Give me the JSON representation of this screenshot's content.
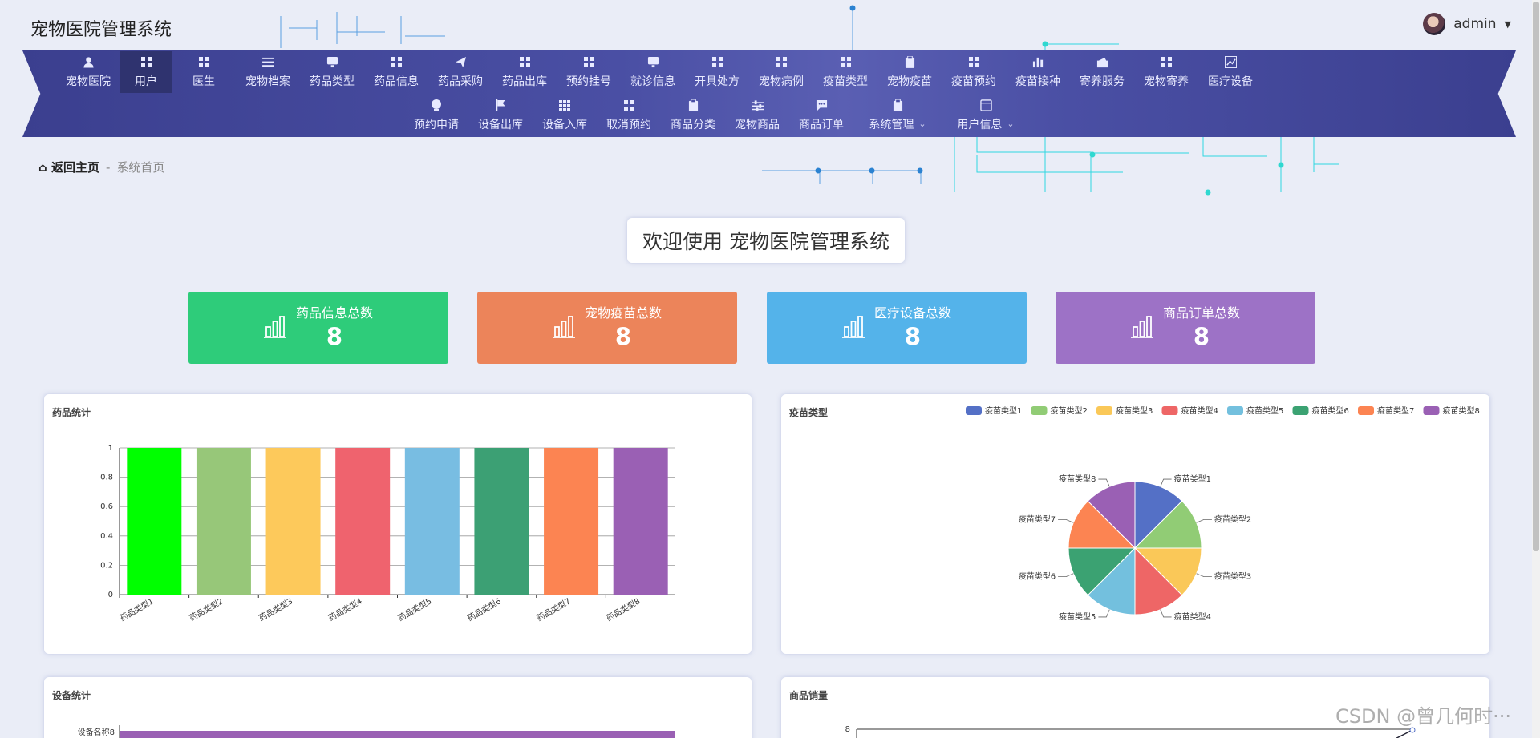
{
  "app": {
    "title": "宠物医院管理系统"
  },
  "user": {
    "name": "admin"
  },
  "nav": {
    "row1": [
      {
        "label": "宠物医院",
        "icon": "user-icon"
      },
      {
        "label": "用户",
        "icon": "grid-icon",
        "active": true
      },
      {
        "label": "医生",
        "icon": "grid-icon"
      },
      {
        "label": "宠物档案",
        "icon": "list-icon"
      },
      {
        "label": "药品类型",
        "icon": "monitor-icon"
      },
      {
        "label": "药品信息",
        "icon": "grid-icon"
      },
      {
        "label": "药品采购",
        "icon": "send-icon"
      },
      {
        "label": "药品出库",
        "icon": "grid-icon"
      },
      {
        "label": "预约挂号",
        "icon": "grid-icon"
      },
      {
        "label": "就诊信息",
        "icon": "monitor-icon"
      },
      {
        "label": "开具处方",
        "icon": "grid-icon"
      },
      {
        "label": "宠物病例",
        "icon": "grid-icon"
      },
      {
        "label": "疫苗类型",
        "icon": "grid-icon"
      },
      {
        "label": "宠物疫苗",
        "icon": "clipboard-icon"
      },
      {
        "label": "疫苗预约",
        "icon": "grid-icon"
      },
      {
        "label": "疫苗接种",
        "icon": "bar-chart-icon"
      },
      {
        "label": "寄养服务",
        "icon": "wallet-icon"
      },
      {
        "label": "宠物寄养",
        "icon": "grid-icon"
      },
      {
        "label": "医疗设备",
        "icon": "line-chart-icon"
      }
    ],
    "row2": [
      {
        "label": "预约申请",
        "icon": "bulb-icon"
      },
      {
        "label": "设备出库",
        "icon": "flag-icon"
      },
      {
        "label": "设备入库",
        "icon": "grid9-icon"
      },
      {
        "label": "取消预约",
        "icon": "grid-icon"
      },
      {
        "label": "商品分类",
        "icon": "clipboard-icon"
      },
      {
        "label": "宠物商品",
        "icon": "sliders-icon"
      },
      {
        "label": "商品订单",
        "icon": "chat-icon"
      },
      {
        "label": "系统管理",
        "icon": "clipboard-icon",
        "dropdown": true
      },
      {
        "label": "用户信息",
        "icon": "window-icon",
        "dropdown": true
      }
    ]
  },
  "breadcrumb": {
    "home": "返回主页",
    "separator": "-",
    "current": "系统首页"
  },
  "welcome": "欢迎使用 宠物医院管理系统",
  "stats": [
    {
      "label": "药品信息总数",
      "value": "8",
      "color": "#2ecc7a"
    },
    {
      "label": "宠物疫苗总数",
      "value": "8",
      "color": "#ec845a"
    },
    {
      "label": "医疗设备总数",
      "value": "8",
      "color": "#54b3ea"
    },
    {
      "label": "商品订单总数",
      "value": "8",
      "color": "#9d72c6"
    }
  ],
  "panels": {
    "drug": "药品统计",
    "vaccine": "疫苗类型",
    "device": "设备统计",
    "goods": "商品销量"
  },
  "chart_data": [
    {
      "type": "bar",
      "title": "药品统计",
      "categories": [
        "药品类型1",
        "药品类型2",
        "药品类型3",
        "药品类型4",
        "药品类型5",
        "药品类型6",
        "药品类型7",
        "药品类型8"
      ],
      "values": [
        1,
        1,
        1,
        1,
        1,
        1,
        1,
        1
      ],
      "ylim": [
        0,
        1
      ],
      "yticks": [
        "0",
        "0.2",
        "0.4",
        "0.6",
        "0.8",
        "1"
      ],
      "colors": [
        "#00ff00",
        "#97c779",
        "#fdc95b",
        "#ef636e",
        "#78bde2",
        "#3ca074",
        "#fc8452",
        "#9a60b4"
      ]
    },
    {
      "type": "pie",
      "title": "疫苗类型",
      "labels": [
        "疫苗类型1",
        "疫苗类型2",
        "疫苗类型3",
        "疫苗类型4",
        "疫苗类型5",
        "疫苗类型6",
        "疫苗类型7",
        "疫苗类型8"
      ],
      "values": [
        1,
        1,
        1,
        1,
        1,
        1,
        1,
        1
      ],
      "colors": [
        "#5470c6",
        "#91cc75",
        "#fac858",
        "#ee6666",
        "#73c0de",
        "#3ba272",
        "#fc8452",
        "#9a60b4"
      ],
      "legend": "top-right"
    },
    {
      "type": "bar",
      "title": "设备统计",
      "visible_category": "设备名称8",
      "color": "#9a60b4"
    },
    {
      "type": "line",
      "title": "商品销量",
      "y_top_tick": "8"
    }
  ],
  "watermark": "CSDN @曾几何时···"
}
